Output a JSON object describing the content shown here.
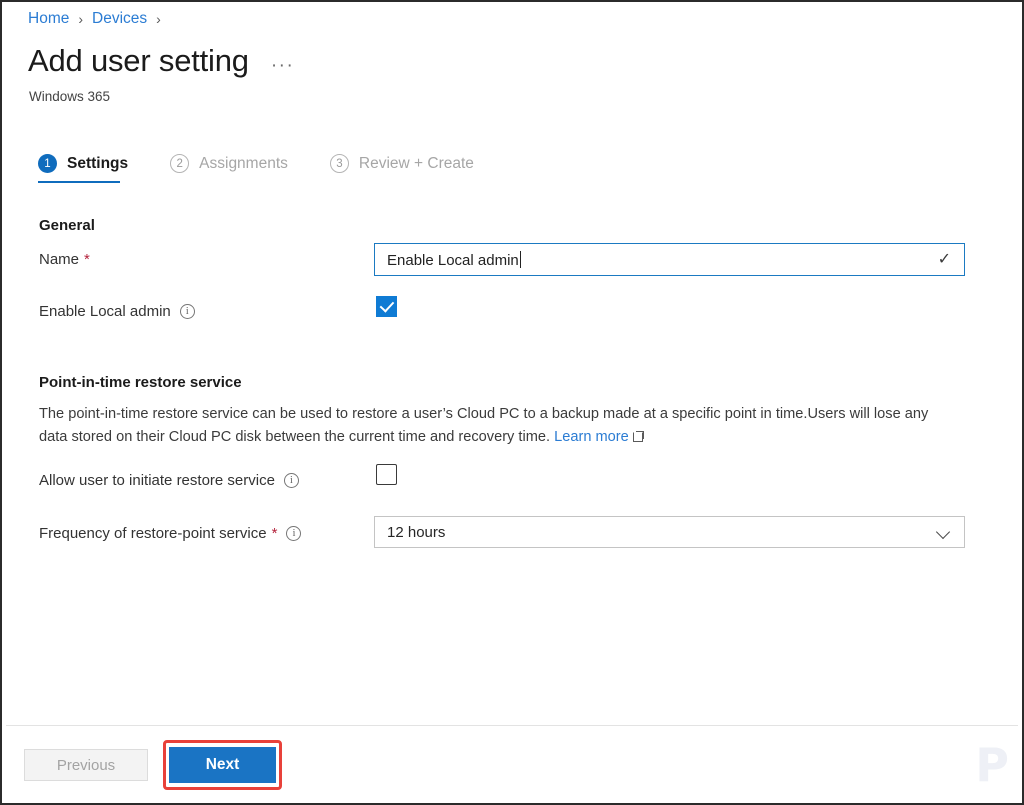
{
  "breadcrumb": {
    "items": [
      {
        "label": "Home"
      },
      {
        "label": "Devices"
      }
    ],
    "separator": "›"
  },
  "header": {
    "title": "Add user setting",
    "subtitle": "Windows 365",
    "overflow_menu": "···"
  },
  "wizard": {
    "steps": [
      {
        "number": "1",
        "label": "Settings",
        "state": "active"
      },
      {
        "number": "2",
        "label": "Assignments",
        "state": "inactive"
      },
      {
        "number": "3",
        "label": "Review + Create",
        "state": "inactive"
      }
    ]
  },
  "general": {
    "section_title": "General",
    "name": {
      "label": "Name",
      "required_marker": "*",
      "value": "Enable Local admin",
      "validation_icon": "✓"
    },
    "enable_local_admin": {
      "label": "Enable Local admin",
      "info_icon": "i",
      "checked": "true"
    }
  },
  "restore": {
    "section_title": "Point-in-time restore service",
    "description_part1": "The point-in-time restore service can be used to restore a user’s Cloud PC to a backup made at a specific point in time.Users will lose any data stored on their Cloud PC disk between the current time and recovery time.",
    "learn_more_label": "Learn more",
    "allow_user": {
      "label": "Allow user to initiate restore service",
      "info_icon": "i",
      "checked": "false"
    },
    "frequency": {
      "label": "Frequency of restore-point service",
      "required_marker": "*",
      "info_icon": "i",
      "selected_value": "12 hours",
      "options": [
        "12 hours"
      ]
    }
  },
  "footer": {
    "previous_label": "Previous",
    "next_label": "Next",
    "watermark": "P"
  },
  "colors": {
    "accent_blue": "#0f6cbd",
    "link_blue": "#2b7cd3",
    "checkbox_blue": "#0f7bd4",
    "required_red": "#b4233c",
    "highlight_red": "#e8413a",
    "next_button_blue": "#1a74c4"
  }
}
